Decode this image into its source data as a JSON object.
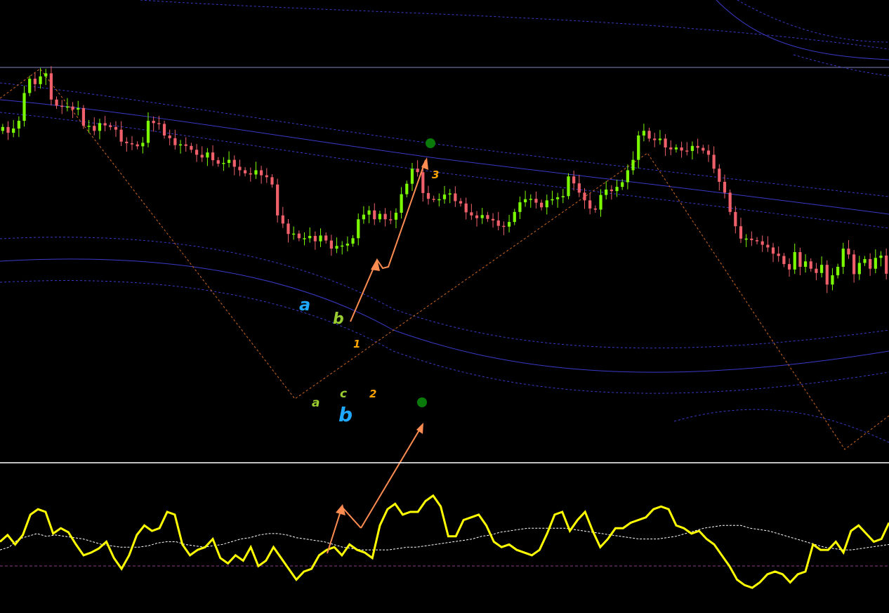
{
  "colors": {
    "background": "#000000",
    "bull": "#7CFC00",
    "bear": "#F0606A",
    "envelope": "#3A3AC8",
    "zigzag": "#D2691E",
    "arrow": "#FF8C50",
    "dot": "#0A7A0A",
    "oscillator": "#FFFF00",
    "signal": "#FFFFFF",
    "oscillator_zero": "#8B3A8B",
    "separator": "#FFFFFF",
    "hline": "#8080C0"
  },
  "annotations": {
    "big_a": "a",
    "big_b": "b",
    "small_b": "b",
    "small_a": "a",
    "small_c": "c",
    "count_1": "1",
    "count_2": "2",
    "count_3": "3"
  },
  "chart_data": [
    {
      "type": "candlestick",
      "title": "",
      "xlabel": "",
      "ylabel": "",
      "ylim": [
        0,
        100
      ],
      "grid": false,
      "legend": "none",
      "series": [
        {
          "x": [
            0,
            1,
            2,
            3,
            4,
            5,
            6,
            7,
            8,
            9,
            10,
            11,
            12,
            13,
            14,
            15,
            16,
            17,
            18,
            19,
            20,
            21,
            22,
            23,
            24,
            25,
            26,
            27,
            28,
            29,
            30,
            31,
            32,
            33,
            34,
            35,
            36,
            37,
            38,
            39,
            40,
            41,
            42,
            43,
            44,
            45,
            46,
            47,
            48,
            49,
            50,
            51,
            52,
            53,
            54,
            55,
            56,
            57,
            58,
            59,
            60,
            61,
            62,
            63,
            64,
            65,
            66,
            67,
            68,
            69,
            70,
            71,
            72,
            73,
            74,
            75,
            76,
            77,
            78,
            79,
            80,
            81,
            82,
            83,
            84,
            85,
            86,
            87,
            88,
            89,
            90,
            91,
            92,
            93,
            94,
            95,
            96,
            97,
            98,
            99,
            100,
            101,
            102,
            103,
            104,
            105,
            106,
            107,
            108,
            109,
            110,
            111,
            112,
            113,
            114,
            115,
            116,
            117,
            118,
            119,
            120,
            121,
            122,
            123,
            124,
            125,
            126,
            127,
            128,
            129,
            130,
            131,
            132,
            133,
            134,
            135,
            136,
            137,
            138,
            139,
            140,
            141,
            142,
            143,
            144,
            145,
            146,
            147,
            148,
            149,
            150,
            151,
            152,
            153,
            154,
            155,
            156,
            157,
            158,
            159,
            160,
            161,
            162,
            163,
            164,
            165,
            166,
            167,
            168,
            169,
            170,
            171,
            172,
            173,
            174,
            175,
            176,
            177,
            178,
            179,
            180,
            181,
            182,
            183,
            184,
            185,
            186,
            187,
            188,
            189,
            190,
            191,
            192,
            193,
            194,
            195,
            196,
            197,
            198,
            199,
            200,
            201,
            202,
            203,
            204,
            205,
            206,
            207,
            208,
            209,
            210
          ],
          "close": [
            85.3,
            83.8,
            84.9,
            86.9,
            94.1,
            97.8,
            96.4,
            98.4,
            99.2,
            92.4,
            90.8,
            90.5,
            90.6,
            89.8,
            90.2,
            85.6,
            85.6,
            84.3,
            86.3,
            85.7,
            85.3,
            84.6,
            81.5,
            81.1,
            80.8,
            80.3,
            81.2,
            86.9,
            86.3,
            86.1,
            83.1,
            82.4,
            80.6,
            80.8,
            80.4,
            79.4,
            78.1,
            77.4,
            78.7,
            76.7,
            75.8,
            76.0,
            76.8,
            75.0,
            74.1,
            73.3,
            73.0,
            74.1,
            72.8,
            72.3,
            70.4,
            62.4,
            60.3,
            57.6,
            57.7,
            56.5,
            56.5,
            57.1,
            55.7,
            57.2,
            55.9,
            53.8,
            54.5,
            54.6,
            55.1,
            56.5,
            61.4,
            62.6,
            63.7,
            61.4,
            62.8,
            61.4,
            61.3,
            63.1,
            67.9,
            70.6,
            74.5,
            73.6,
            68.2,
            66.7,
            66.6,
            66.6,
            67.8,
            68.1,
            66.1,
            65.5,
            63.2,
            62.4,
            61.7,
            62.5,
            61.5,
            61.1,
            59.7,
            59.5,
            60.7,
            63.3,
            65.8,
            66.6,
            66.7,
            65.7,
            64.5,
            66.3,
            66.6,
            67.1,
            67.4,
            72.5,
            70.7,
            68.3,
            66.3,
            64.2,
            63.9,
            67.7,
            69.1,
            68.7,
            69.8,
            71.0,
            74.1,
            76.8,
            83.1,
            84.3,
            82.3,
            81.9,
            82.3,
            80.0,
            79.5,
            80.0,
            79.2,
            79.1,
            80.4,
            79.9,
            79.2,
            78.1,
            74.5,
            71.1,
            68.3,
            63.3,
            59.6,
            56.4,
            56.4,
            56.0,
            55.7,
            54.8,
            54.1,
            52.5,
            51.9,
            49.8,
            48.4,
            52.9,
            49.1,
            50.5,
            48.6,
            47.5,
            49.6,
            44.5,
            46.9,
            49.1,
            53.8,
            52.3,
            47.2,
            50.1,
            51.1,
            48.6,
            51.4,
            52.0,
            47.3
          ]
        }
      ]
    },
    {
      "type": "line",
      "title": "",
      "xlabel": "",
      "ylabel": "",
      "ylim": [
        0,
        100
      ],
      "grid": false,
      "legend": "none",
      "series": [
        {
          "values": [
            50,
            55,
            48,
            55,
            70,
            74,
            72,
            56,
            60,
            57,
            48,
            40,
            42,
            45,
            50,
            38,
            30,
            40,
            55,
            62,
            58,
            60,
            72,
            70,
            48,
            40,
            44,
            46,
            52,
            38,
            34,
            40,
            36,
            46,
            32,
            36,
            46,
            38,
            30,
            22,
            28,
            30,
            40,
            44,
            46,
            40,
            48,
            44,
            42,
            38,
            62,
            74,
            78,
            70,
            72,
            72,
            80,
            84,
            76,
            54,
            54,
            66,
            68,
            70,
            62,
            50,
            46,
            48,
            44,
            42,
            40,
            44,
            56,
            70,
            72,
            58,
            66,
            72,
            58,
            46,
            52,
            60,
            60,
            64,
            66,
            68,
            74,
            76,
            74,
            62,
            60,
            56,
            58,
            52,
            48,
            40,
            32,
            22,
            18,
            16,
            20,
            26,
            28,
            26,
            20,
            26,
            28,
            48,
            44,
            44,
            50,
            42,
            58,
            62,
            56,
            50,
            52,
            64
          ]
        },
        {
          "values": [
            44,
            46,
            52,
            54,
            56,
            54,
            55,
            54,
            53,
            52,
            50,
            48,
            47,
            46,
            46,
            46,
            47,
            49,
            50,
            50,
            48,
            47,
            46,
            47,
            48,
            50,
            52,
            53,
            55,
            56,
            56,
            55,
            53,
            52,
            51,
            50,
            48,
            46,
            45,
            44,
            44,
            44,
            44,
            45,
            46,
            46,
            47,
            48,
            49,
            50,
            51,
            52,
            54,
            55,
            57,
            58,
            59,
            60,
            60,
            60,
            60,
            60,
            59,
            58,
            57,
            56,
            55,
            54,
            53,
            52,
            52,
            52,
            53,
            54,
            56,
            58,
            60,
            61,
            62,
            62,
            62,
            60,
            59,
            58,
            56,
            54,
            52,
            50,
            48,
            46,
            45,
            44,
            44,
            45,
            46,
            47,
            48
          ]
        }
      ]
    }
  ]
}
